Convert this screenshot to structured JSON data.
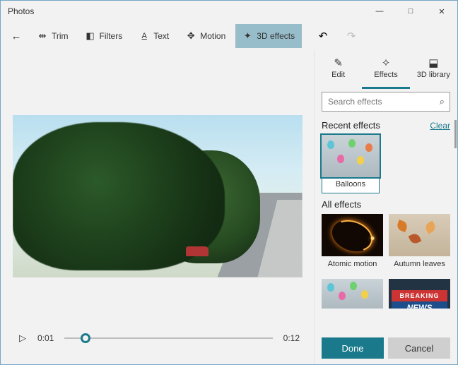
{
  "app_title": "Photos",
  "window": {
    "minimize": "—",
    "maximize": "□",
    "close": "✕"
  },
  "toolbar": {
    "back": "←",
    "items": [
      {
        "label": "Trim",
        "icon": "✂"
      },
      {
        "label": "Filters",
        "icon": "◧"
      },
      {
        "label": "Text",
        "icon": "A̲"
      },
      {
        "label": "Motion",
        "icon": "⟲"
      },
      {
        "label": "3D effects",
        "icon": "✦",
        "active": true
      }
    ],
    "undo": "↶",
    "redo": "↷"
  },
  "player": {
    "play_icon": "▷",
    "current": "0:01",
    "duration": "0:12",
    "progress_pct": 10
  },
  "panel": {
    "tabs": [
      {
        "label": "Edit",
        "icon": "✎"
      },
      {
        "label": "Effects",
        "icon": "✧",
        "active": true
      },
      {
        "label": "3D library",
        "icon": "⬚"
      }
    ],
    "search_placeholder": "Search effects",
    "recent_header": "Recent effects",
    "clear_label": "Clear",
    "recent": [
      {
        "name": "Balloons",
        "kind": "balloons",
        "selected": true
      }
    ],
    "all_header": "All effects",
    "all": [
      {
        "name": "Atomic motion",
        "kind": "atomic"
      },
      {
        "name": "Autumn leaves",
        "kind": "leaves"
      },
      {
        "name": "",
        "kind": "balloons"
      },
      {
        "name": "",
        "kind": "breaking"
      }
    ],
    "done": "Done",
    "cancel": "Cancel"
  }
}
